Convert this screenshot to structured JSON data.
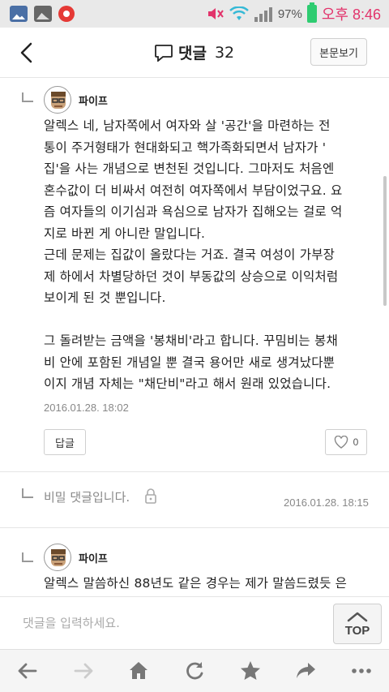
{
  "status_bar": {
    "battery_percent": "97%",
    "time": "오후 8:46",
    "icons": [
      "gallery-icon",
      "image-icon",
      "record-icon",
      "mute-icon",
      "wifi-icon",
      "signal-icon",
      "battery-icon"
    ]
  },
  "header": {
    "title": "댓글",
    "count": "32",
    "view_original_label": "본문보기",
    "icons": [
      "back-arrow-icon",
      "comment-bubble-icon"
    ]
  },
  "comments": [
    {
      "author": "파이프",
      "lines": [
        "알렉스 네, 남자쪽에서 여자와 살 '공간'을 마련하는 전",
        "통이 주거형태가 현대화되고 핵가족화되면서 남자가 '",
        "집'을 사는 개념으로 변천된 것입니다. 그마저도 처음엔",
        "혼수값이 더 비싸서 여전히 여자쪽에서 부담이었구요. 요",
        "즘 여자들의 이기심과 욕심으로 남자가 집해오는 걸로 억",
        "지로 바뀐 게 아니란 말입니다.",
        "근데 문제는 집값이 올랐다는 거죠. 결국 여성이 가부장",
        "제 하에서 차별당하던 것이 부동값의 상승으로 이익처럼",
        "보이게 된 것 뿐입니다.",
        "",
        "그 돌려받는 금액을 '봉채비'라고 합니다. 꾸밈비는 봉채",
        "비 안에 포함된 개념일 뿐 결국 용어만 새로 생겨났다뿐",
        "이지 개념 자체는 \"채단비\"라고 해서 원래 있었습니다."
      ],
      "date": "2016.01.28. 18:02",
      "reply_label": "답글",
      "like_count": "0"
    },
    {
      "secret_text": "비밀 댓글입니다.",
      "date": "2016.01.28. 18:15"
    },
    {
      "author": "파이프",
      "lines": [
        "알렉스 말씀하신 88년도 같은 경우는 제가 말씀드렸듯 은"
      ]
    }
  ],
  "input_bar": {
    "placeholder": "댓글을 입력하세요.",
    "top_label": "TOP"
  },
  "bottom_nav": {
    "items": [
      "back-icon",
      "forward-icon",
      "home-icon",
      "refresh-icon",
      "bookmark-star-icon",
      "share-icon",
      "more-icon"
    ]
  }
}
